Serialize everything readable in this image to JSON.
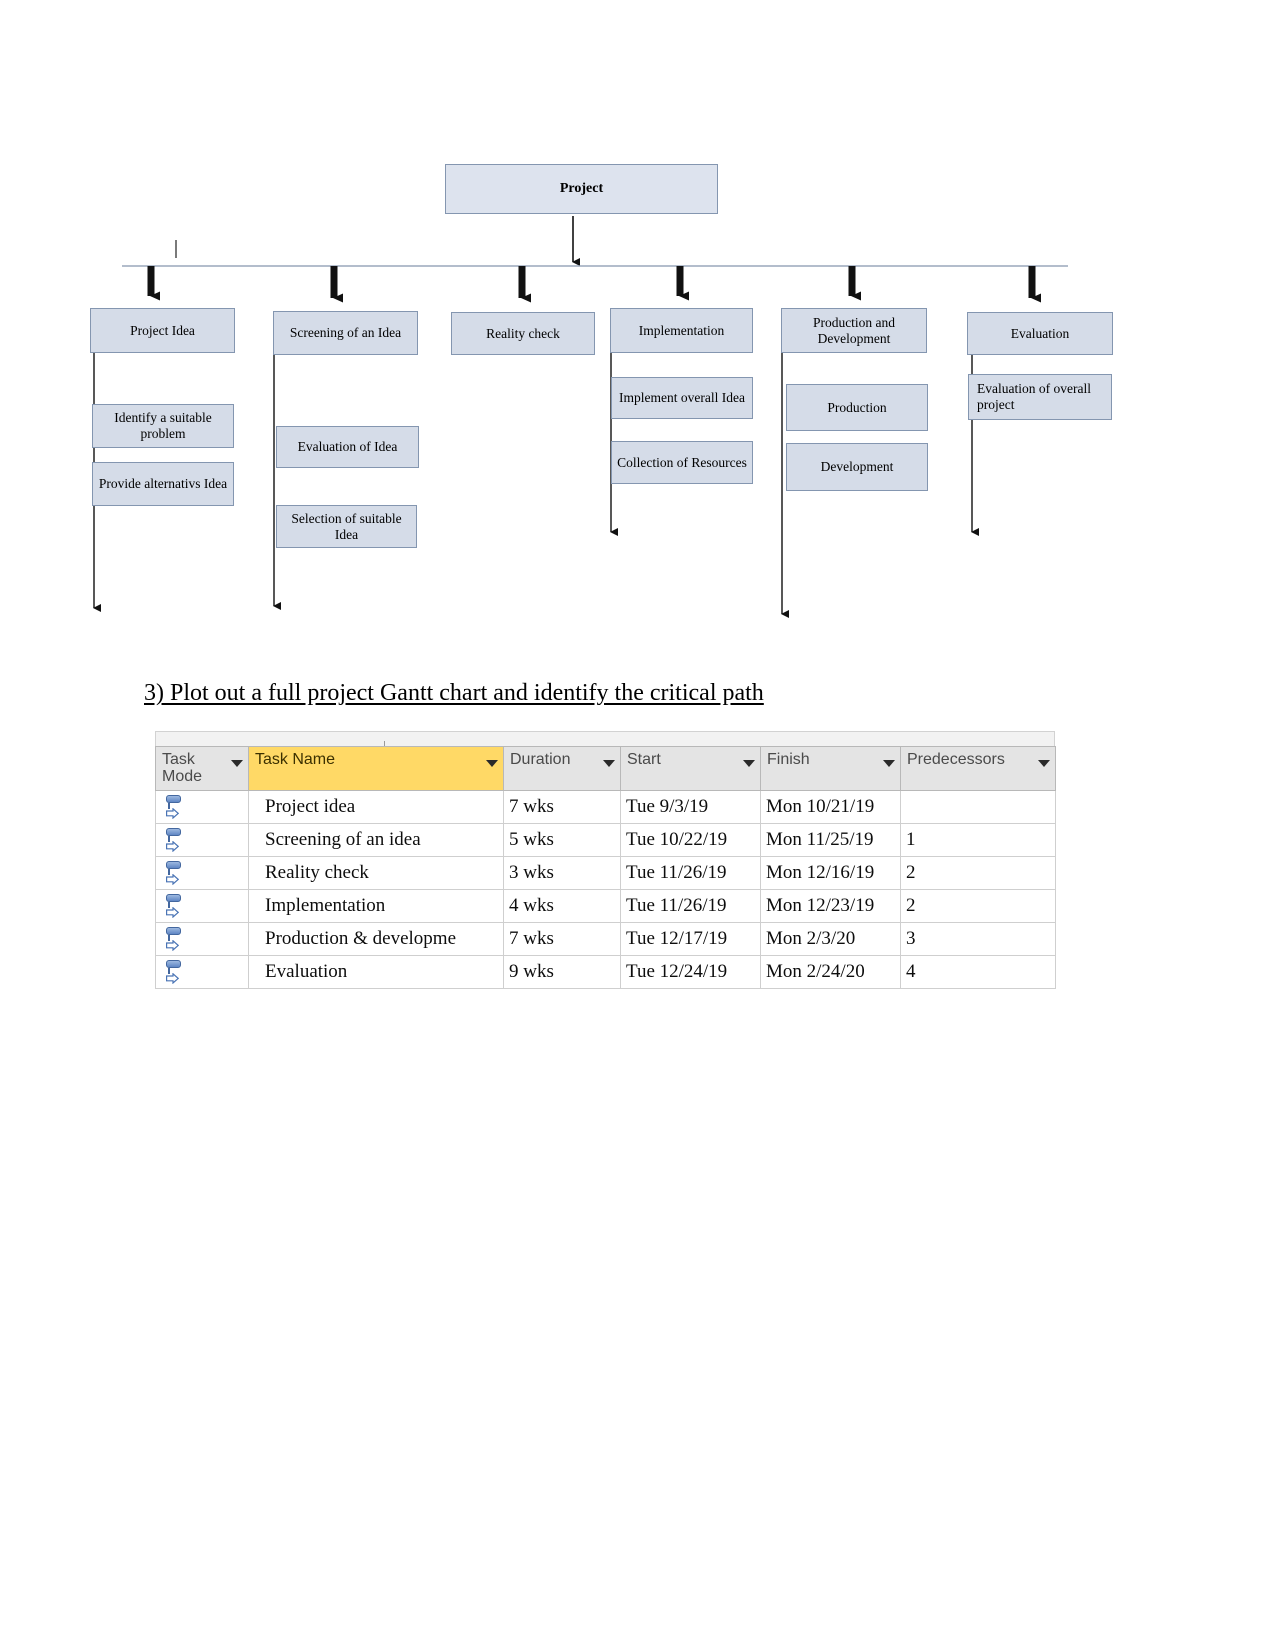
{
  "wbs": {
    "root": {
      "label": "Project"
    },
    "level1": [
      {
        "label": "Project Idea"
      },
      {
        "label": "Screening of an Idea"
      },
      {
        "label": "Reality check"
      },
      {
        "label": "Implementation"
      },
      {
        "label": "Production and Development"
      },
      {
        "label": "Evaluation"
      }
    ],
    "level2": [
      {
        "label": "Identify a suitable problem",
        "parent": "Project Idea"
      },
      {
        "label": "Provide alternativs Idea",
        "parent": "Project Idea"
      },
      {
        "label": "Evaluation of Idea",
        "parent": "Screening of an Idea"
      },
      {
        "label": "Selection of suitable Idea",
        "parent": "Screening of an Idea"
      },
      {
        "label": "Implement overall Idea",
        "parent": "Implementation"
      },
      {
        "label": "Collection of Resources",
        "parent": "Implementation"
      },
      {
        "label": "Production",
        "parent": "Production and Development"
      },
      {
        "label": "Development",
        "parent": "Production and Development"
      },
      {
        "label": "Evaluation of overall project",
        "parent": "Evaluation"
      }
    ],
    "colors": {
      "box_fill": "#d5dce8",
      "box_border": "#8496b0",
      "connector": "#1a1a1a"
    }
  },
  "heading": {
    "text": "3) Plot out a full project Gantt chart and identify the critical path"
  },
  "gantt": {
    "columns": [
      {
        "label": "Task\nMode",
        "highlight": false
      },
      {
        "label": "Task Name",
        "highlight": true
      },
      {
        "label": "Duration",
        "highlight": false
      },
      {
        "label": "Start",
        "highlight": false
      },
      {
        "label": "Finish",
        "highlight": false
      },
      {
        "label": "Predecessors",
        "highlight": false
      }
    ],
    "highlight_color": "#ffd966",
    "rows": [
      {
        "mode_icon": "manually-scheduled-icon",
        "name": "Project idea",
        "duration": "7 wks",
        "start": "Tue 9/3/19",
        "finish": "Mon 10/21/19",
        "predecessors": ""
      },
      {
        "mode_icon": "manually-scheduled-icon",
        "name": "Screening of an idea",
        "duration": "5 wks",
        "start": "Tue 10/22/19",
        "finish": "Mon 11/25/19",
        "predecessors": "1"
      },
      {
        "mode_icon": "manually-scheduled-icon",
        "name": "Reality check",
        "duration": "3 wks",
        "start": "Tue 11/26/19",
        "finish": "Mon 12/16/19",
        "predecessors": "2"
      },
      {
        "mode_icon": "manually-scheduled-icon",
        "name": "Implementation",
        "duration": "4 wks",
        "start": "Tue 11/26/19",
        "finish": "Mon 12/23/19",
        "predecessors": "2"
      },
      {
        "mode_icon": "manually-scheduled-icon",
        "name": "Production & developme",
        "duration": "7 wks",
        "start": "Tue 12/17/19",
        "finish": "Mon 2/3/20",
        "predecessors": "3"
      },
      {
        "mode_icon": "manually-scheduled-icon",
        "name": "Evaluation",
        "duration": "9 wks",
        "start": "Tue 12/24/19",
        "finish": "Mon 2/24/20",
        "predecessors": "4"
      }
    ]
  }
}
